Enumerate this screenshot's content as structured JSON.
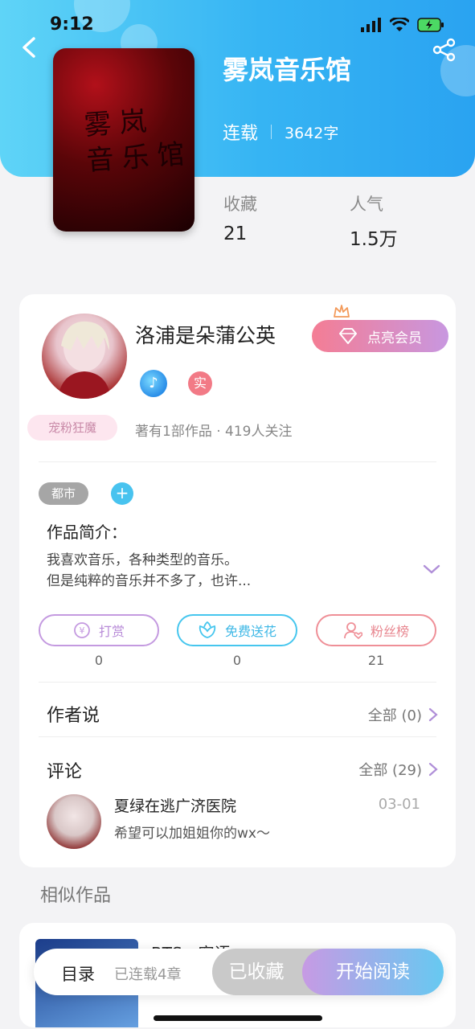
{
  "status_bar": {
    "time": "9:12"
  },
  "book": {
    "title": "雾岚音乐馆",
    "cover_text": "雾岚\n音乐馆",
    "status": "连载",
    "word_count": "3642字",
    "favorites_label": "收藏",
    "favorites_value": "21",
    "popularity_label": "人气",
    "popularity_value": "1.5万"
  },
  "author": {
    "name": "洛浦是朵蒲公英",
    "fan_badge": "宠粉狂魔",
    "vip_button": "点亮会员",
    "real_badge": "实",
    "stats": "著有1部作品 · 419人关注"
  },
  "intro": {
    "tag": "都市",
    "add_tag": "+",
    "title": "作品简介：",
    "text_line1": "我喜欢音乐，各种类型的音乐。",
    "text_line2": "但是纯粹的音乐并不多了，也许..."
  },
  "actions": [
    {
      "label": "打赏",
      "count": "0",
      "icon": "yen-icon"
    },
    {
      "label": "免费送花",
      "count": "0",
      "icon": "flower-icon"
    },
    {
      "label": "粉丝榜",
      "count": "21",
      "icon": "fans-icon"
    }
  ],
  "author_says": {
    "title": "作者说",
    "link": "全部 (0)"
  },
  "comments": {
    "title": "评论",
    "link": "全部 (29)",
    "items": [
      {
        "user": "夏绿在逃广济医院",
        "date": "03-01",
        "text": "希望可以加姐姐你的wx～"
      }
    ]
  },
  "similar": {
    "title": "相似作品",
    "item_name": "BTS：密语"
  },
  "bottom_bar": {
    "toc": "目录",
    "chapters": "已连载4章",
    "collected": "已收藏",
    "start_reading": "开始阅读"
  },
  "colors": {
    "header_gradient_start": "#5fd4f7",
    "header_gradient_end": "#2aa3f1",
    "vip_pink": "#f47d94",
    "vip_purple": "#c897e0",
    "reward_purple": "#c49ae0",
    "flower_cyan": "#46c6ee",
    "fans_pink": "#ef8f97"
  }
}
